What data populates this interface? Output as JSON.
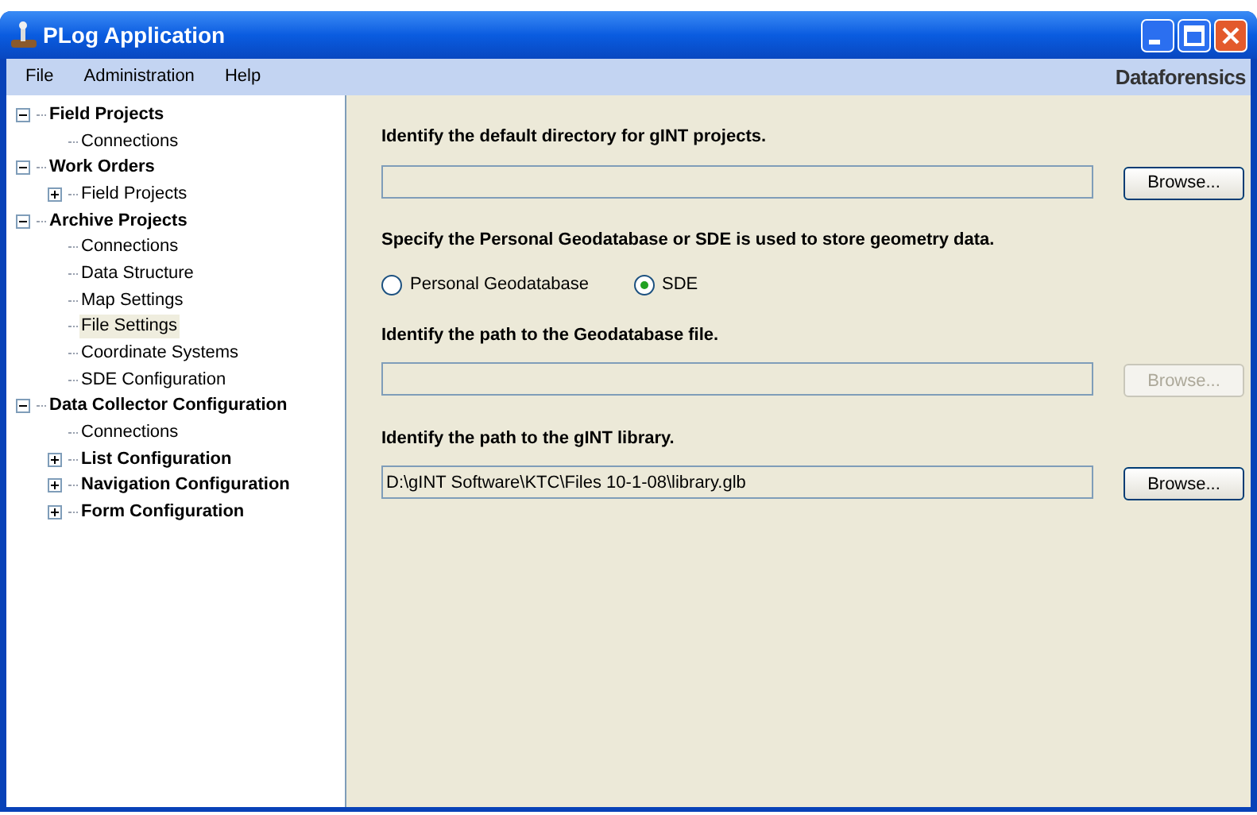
{
  "window": {
    "title": "PLog Application"
  },
  "menu": [
    {
      "label": "File"
    },
    {
      "label": "Administration"
    },
    {
      "label": "Help"
    }
  ],
  "brand": "Dataforensics",
  "tree": [
    {
      "label": "Field Projects",
      "bold": true,
      "expanded": true,
      "selected": false,
      "children": [
        {
          "label": "Connections",
          "selected": false
        }
      ]
    },
    {
      "label": "Work Orders",
      "bold": true,
      "expanded": true,
      "selected": false,
      "children": [
        {
          "label": "Field Projects",
          "bold": false,
          "expanded": false,
          "selected": false
        }
      ]
    },
    {
      "label": "Archive Projects",
      "bold": true,
      "expanded": true,
      "selected": false,
      "children": [
        {
          "label": "Connections",
          "selected": false
        },
        {
          "label": "Data Structure",
          "selected": false
        },
        {
          "label": "Map Settings",
          "selected": false
        },
        {
          "label": "File Settings",
          "selected": true
        },
        {
          "label": "Coordinate Systems",
          "selected": false
        },
        {
          "label": "SDE Configuration",
          "selected": false
        }
      ]
    },
    {
      "label": "Data Collector Configuration",
      "bold": true,
      "expanded": true,
      "selected": false,
      "children": [
        {
          "label": "Connections",
          "selected": false
        },
        {
          "label": "List Configuration",
          "bold": true,
          "expanded": false,
          "selected": false
        },
        {
          "label": "Navigation Configuration",
          "bold": true,
          "expanded": false,
          "selected": false
        },
        {
          "label": "Form Configuration",
          "bold": true,
          "expanded": false,
          "selected": false
        }
      ]
    }
  ],
  "form": [
    {
      "kind": "label",
      "text": "Identify the default directory for gINT projects."
    },
    {
      "kind": "path",
      "button": "Browse...",
      "disabled": false
    },
    {
      "kind": "label",
      "text": "Specify the Personal Geodatabase or SDE is used to store geometry data."
    },
    {
      "kind": "radios",
      "options": [
        {
          "label": "Personal Geodatabase",
          "selected": false
        },
        {
          "label": "SDE",
          "selected": true
        }
      ]
    },
    {
      "kind": "label",
      "text": "Identify the path to the Geodatabase file."
    },
    {
      "kind": "path",
      "button": "Browse...",
      "disabled": true
    },
    {
      "kind": "label",
      "text": "Identify the path to the gINT library."
    },
    {
      "kind": "path",
      "value": "D:\\gINT Software\\KTC\\Files 10-1-08\\library.glb",
      "button": "Browse...",
      "disabled": false
    }
  ]
}
